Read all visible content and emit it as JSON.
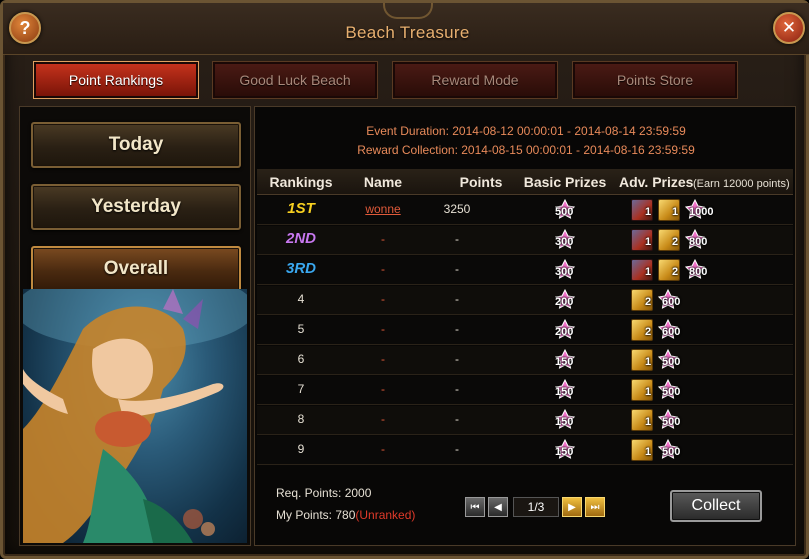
{
  "window": {
    "title": "Beach Treasure",
    "help_label": "?",
    "close_label": "✕"
  },
  "tabs": [
    {
      "label": "Point Rankings",
      "active": true
    },
    {
      "label": "Good Luck Beach",
      "active": false
    },
    {
      "label": "Reward Mode",
      "active": false
    },
    {
      "label": "Points Store",
      "active": false
    }
  ],
  "sidebar": {
    "buttons": [
      {
        "label": "Today",
        "active": false
      },
      {
        "label": "Yesterday",
        "active": false
      },
      {
        "label": "Overall",
        "active": true
      }
    ]
  },
  "event": {
    "duration": "Event Duration: 2014-08-12 00:00:01 - 2014-08-14 23:59:59",
    "collection": "Reward Collection: 2014-08-15 00:00:01 - 2014-08-16 23:59:59"
  },
  "table": {
    "headers": {
      "rankings": "Rankings",
      "name": "Name",
      "points": "Points",
      "basic": "Basic Prizes",
      "adv": "Adv. Prizes",
      "earn_note": "(Earn 12000 points)"
    },
    "rows": [
      {
        "rank": "1ST",
        "rank_color": "#f8d020",
        "name": "wonne",
        "points": "3250",
        "basic": "500",
        "adv": [
          {
            "type": "red",
            "qty": "1"
          },
          {
            "type": "gold-red",
            "qty": "1"
          },
          {
            "type": "gem",
            "qty": "1000"
          }
        ]
      },
      {
        "rank": "2ND",
        "rank_color": "#c878f0",
        "name": "-",
        "points": "-",
        "basic": "300",
        "adv": [
          {
            "type": "red",
            "qty": "1"
          },
          {
            "type": "gold",
            "qty": "2"
          },
          {
            "type": "gem",
            "qty": "800"
          }
        ]
      },
      {
        "rank": "3RD",
        "rank_color": "#3aa8f0",
        "name": "-",
        "points": "-",
        "basic": "300",
        "adv": [
          {
            "type": "red",
            "qty": "1"
          },
          {
            "type": "gold",
            "qty": "2"
          },
          {
            "type": "gem",
            "qty": "800"
          }
        ]
      },
      {
        "rank": "4",
        "rank_color": "#e6e0d4",
        "name": "-",
        "points": "-",
        "basic": "200",
        "adv": [
          {
            "type": "gold",
            "qty": "2"
          },
          {
            "type": "gem",
            "qty": "600"
          }
        ]
      },
      {
        "rank": "5",
        "rank_color": "#e6e0d4",
        "name": "-",
        "points": "-",
        "basic": "200",
        "adv": [
          {
            "type": "gold",
            "qty": "2"
          },
          {
            "type": "gem",
            "qty": "600"
          }
        ]
      },
      {
        "rank": "6",
        "rank_color": "#e6e0d4",
        "name": "-",
        "points": "-",
        "basic": "150",
        "adv": [
          {
            "type": "gold",
            "qty": "1"
          },
          {
            "type": "gem",
            "qty": "500"
          }
        ]
      },
      {
        "rank": "7",
        "rank_color": "#e6e0d4",
        "name": "-",
        "points": "-",
        "basic": "150",
        "adv": [
          {
            "type": "gold",
            "qty": "1"
          },
          {
            "type": "gem",
            "qty": "500"
          }
        ]
      },
      {
        "rank": "8",
        "rank_color": "#e6e0d4",
        "name": "-",
        "points": "-",
        "basic": "150",
        "adv": [
          {
            "type": "gold",
            "qty": "1"
          },
          {
            "type": "gem",
            "qty": "500"
          }
        ]
      },
      {
        "rank": "9",
        "rank_color": "#e6e0d4",
        "name": "-",
        "points": "-",
        "basic": "150",
        "adv": [
          {
            "type": "gold",
            "qty": "1"
          },
          {
            "type": "gem",
            "qty": "500"
          }
        ]
      }
    ]
  },
  "footer": {
    "req_points": "Req. Points: 2000",
    "my_points_label": "My Points: 780",
    "my_points_status": "(Unranked)",
    "page": "1/3",
    "collect_label": "Collect"
  },
  "colors": {
    "accent_red": "#c4321c",
    "gold": "#e8b070",
    "dash_red": "#e05a3a"
  }
}
